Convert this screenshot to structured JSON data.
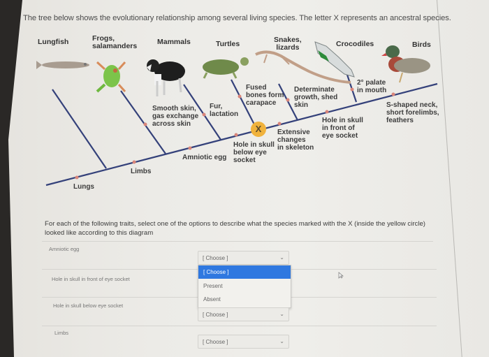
{
  "intro_text": "The tree below shows the evolutionary relationship among several living species. The letter X represents an ancestral species.",
  "taxa": {
    "lungfish": "Lungfish",
    "frogs_1": "Frogs,",
    "frogs_2": "salamanders",
    "mammals": "Mammals",
    "turtles": "Turtles",
    "snakes_1": "Snakes,",
    "snakes_2": "lizards",
    "crocodiles": "Crocodiles",
    "birds": "Birds"
  },
  "traits": {
    "lungs": "Lungs",
    "limbs": "Limbs",
    "amniotic_egg": "Amniotic egg",
    "smooth_skin": [
      "Smooth skin,",
      "gas exchange",
      "across skin"
    ],
    "fur": [
      "Fur,",
      "lactation"
    ],
    "fused_bones": [
      "Fused",
      "bones form",
      "carapace"
    ],
    "hole_below": [
      "Hole in skull",
      "below eye",
      "socket"
    ],
    "extensive": [
      "Extensive",
      "changes",
      "in skeleton"
    ],
    "determinate": [
      "Determinate",
      "growth, shed",
      "skin"
    ],
    "hole_front": [
      "Hole in skull",
      "in front of",
      "eye socket"
    ],
    "palate": [
      "2° palate",
      "in mouth"
    ],
    "s_neck": [
      "S-shaped neck,",
      "short forelimbs,",
      "feathers"
    ]
  },
  "ancestor_marker": "X",
  "colors": {
    "branch": "#34417a",
    "trait_dot": "#d9857a",
    "ancestor_circle": "#f0b23c",
    "dropdown_highlight": "#2f78e0"
  },
  "question_text": "For each of the following traits, select one of the options to describe what the species marked with the X (inside the yellow circle) looked like according to this diagram",
  "rows": [
    {
      "label": "Amniotic egg",
      "value": "[ Choose ]"
    },
    {
      "label": "Hole in skull in front of eye socket",
      "value": ""
    },
    {
      "label": "Hole in skull below eye socket",
      "value": "[ Choose ]"
    },
    {
      "label": "Limbs",
      "value": "[ Choose ]"
    }
  ],
  "dropdown": {
    "options": [
      "[ Choose ]",
      "Present",
      "Absent"
    ],
    "highlighted": "[ Choose ]"
  }
}
